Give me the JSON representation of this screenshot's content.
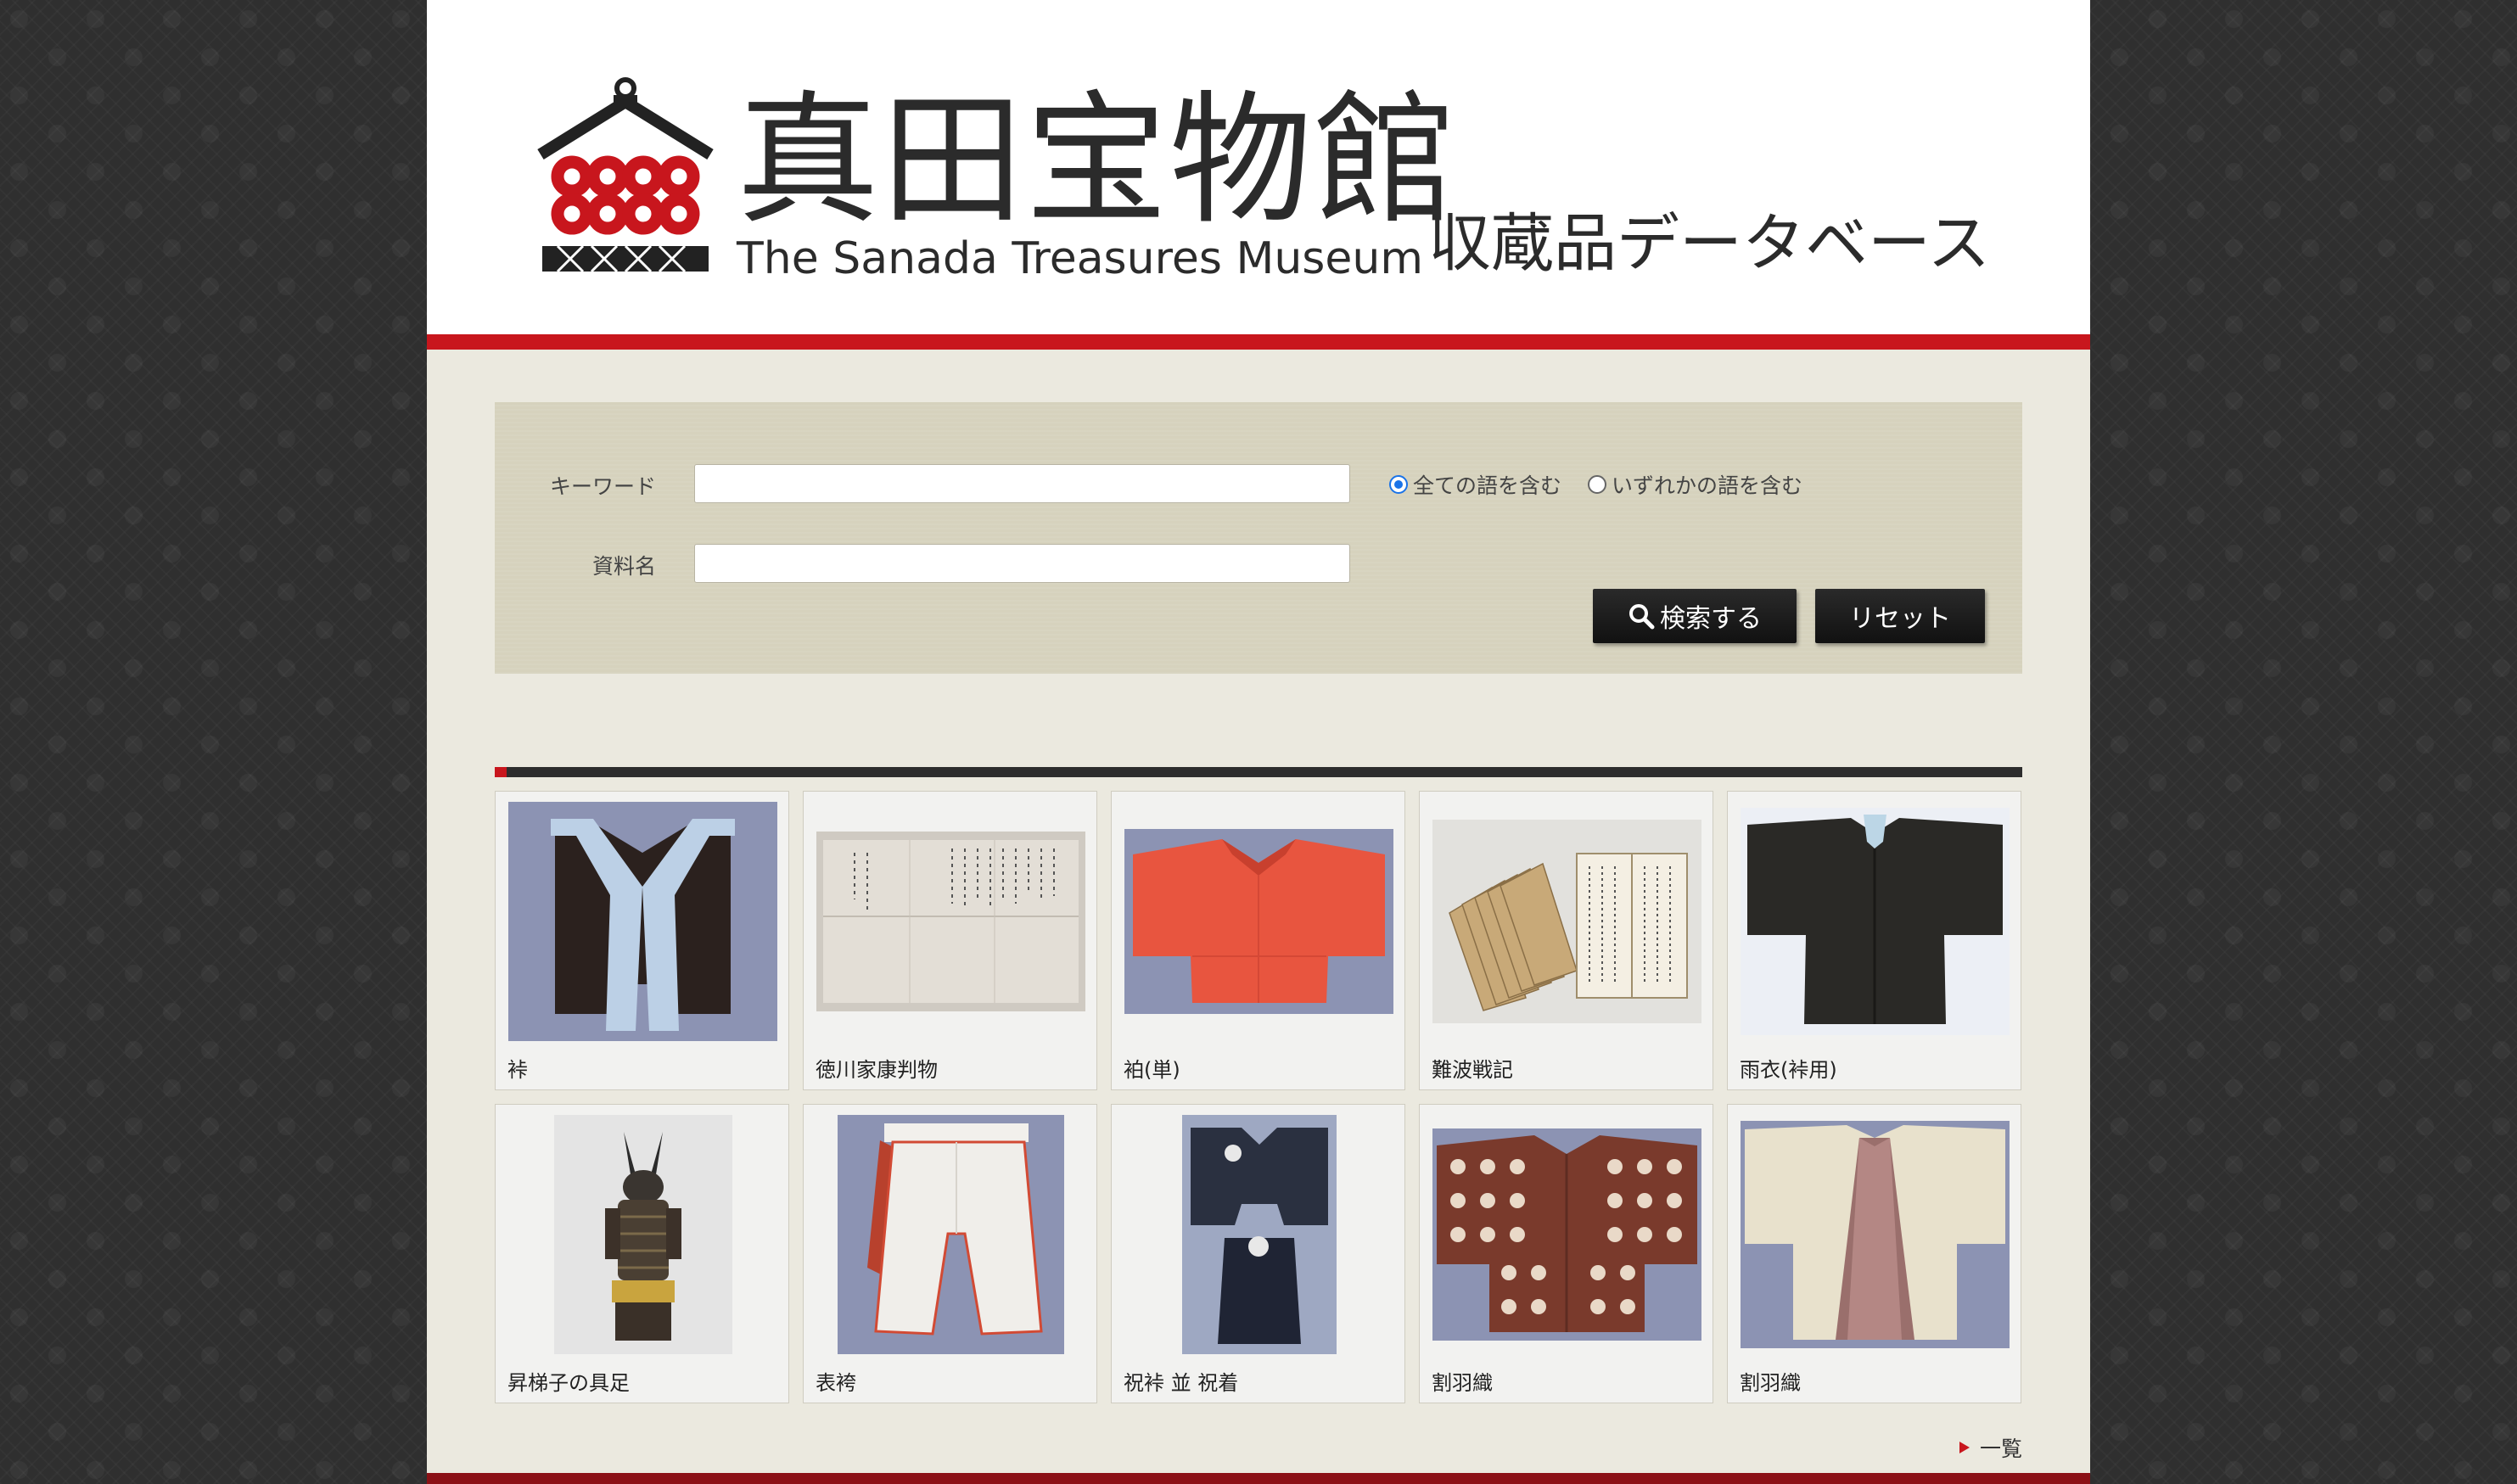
{
  "header": {
    "logo_jp": "真田宝物館",
    "logo_en": "The Sanada Treasures Museum",
    "db_title": "収蔵品データベース"
  },
  "search": {
    "keyword_label": "キーワード",
    "keyword_value": "",
    "name_label": "資料名",
    "name_value": "",
    "match_all_label": "全ての語を含む",
    "match_any_label": "いずれかの語を含む",
    "match_selected": "all",
    "search_button": "検索する",
    "reset_button": "リセット"
  },
  "items": [
    {
      "caption": "裃"
    },
    {
      "caption": "徳川家康判物"
    },
    {
      "caption": "袙(単)"
    },
    {
      "caption": "難波戦記"
    },
    {
      "caption": "雨衣(裃用)"
    },
    {
      "caption": "昇梯子の具足"
    },
    {
      "caption": "表袴"
    },
    {
      "caption": "祝裃 並 祝着"
    },
    {
      "caption": "割羽織"
    },
    {
      "caption": "割羽織"
    }
  ],
  "footer": {
    "more_label": "一覧"
  },
  "colors": {
    "accent_red": "#c8161d",
    "button_black": "#1a1a1a",
    "panel_beige": "#d6d2bd",
    "page_bg": "#ebe9df"
  },
  "icons": [
    "search-icon",
    "sanada-logo-icon"
  ]
}
